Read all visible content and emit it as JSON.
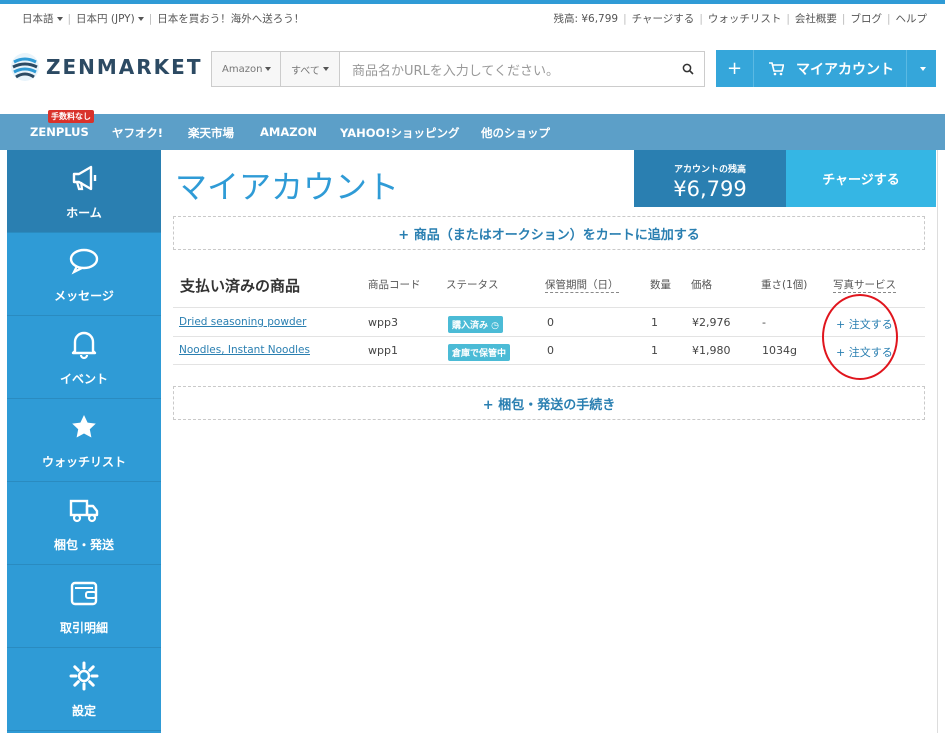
{
  "topbar": {
    "lang": "日本語",
    "currency": "日本円 (JPY)",
    "slogan": "日本を買おう！海外へ送ろう！",
    "links": [
      "残高: ¥6,799",
      "チャージする",
      "ウォッチリスト",
      "会社概要",
      "ブログ",
      "ヘルプ"
    ]
  },
  "header": {
    "logo_text": "ZENMARKET",
    "search": {
      "source": "Amazon",
      "category": "すべて",
      "placeholder": "商品名かURLを入力してください。"
    },
    "account_plus": "+",
    "account_label": "マイアカウント"
  },
  "nav": {
    "badge": "手数料なし",
    "items": [
      "ZENPLUS",
      "ヤフオク!",
      "楽天市場",
      "AMAZON",
      "YAHOO!ショッピング",
      "他のショップ"
    ]
  },
  "sidebar": {
    "items": [
      {
        "label": "ホーム",
        "icon": "megaphone-icon"
      },
      {
        "label": "メッセージ",
        "icon": "speech-bubble-icon"
      },
      {
        "label": "イベント",
        "icon": "bell-icon"
      },
      {
        "label": "ウォッチリスト",
        "icon": "star-icon"
      },
      {
        "label": "梱包・発送",
        "icon": "truck-icon"
      },
      {
        "label": "取引明細",
        "icon": "wallet-icon"
      },
      {
        "label": "設定",
        "icon": "gear-icon"
      }
    ]
  },
  "main": {
    "title": "マイアカウント",
    "balance_label": "アカウントの残高",
    "balance_amount": "¥6,799",
    "charge_label": "チャージする",
    "add_to_cart": "+ 商品（またはオークション）をカートに追加する",
    "ship_procedure": "+ 梱包・発送の手続き",
    "table": {
      "title": "支払い済みの商品",
      "headers": [
        "商品コード",
        "ステータス",
        "保管期間（日）",
        "数量",
        "価格",
        "重さ(1個)",
        "写真サービス"
      ],
      "rows": [
        {
          "name": "Dried seasoning powder",
          "code": "wpp3",
          "status": "購入済み",
          "storage": "0",
          "qty": "1",
          "price": "¥2,976",
          "weight": "-",
          "photo": "+ 注文する"
        },
        {
          "name": "Noodles, Instant Noodles",
          "code": "wpp1",
          "status": "倉庫で保管中",
          "storage": "0",
          "qty": "1",
          "price": "¥1,980",
          "weight": "1034g",
          "photo": "+ 注文する"
        }
      ]
    }
  },
  "colors": {
    "brand": "#2f9bd6",
    "sidebar_active": "#2a7fb1",
    "nav": "#5c9fc8",
    "annotation": "#e0151d"
  }
}
